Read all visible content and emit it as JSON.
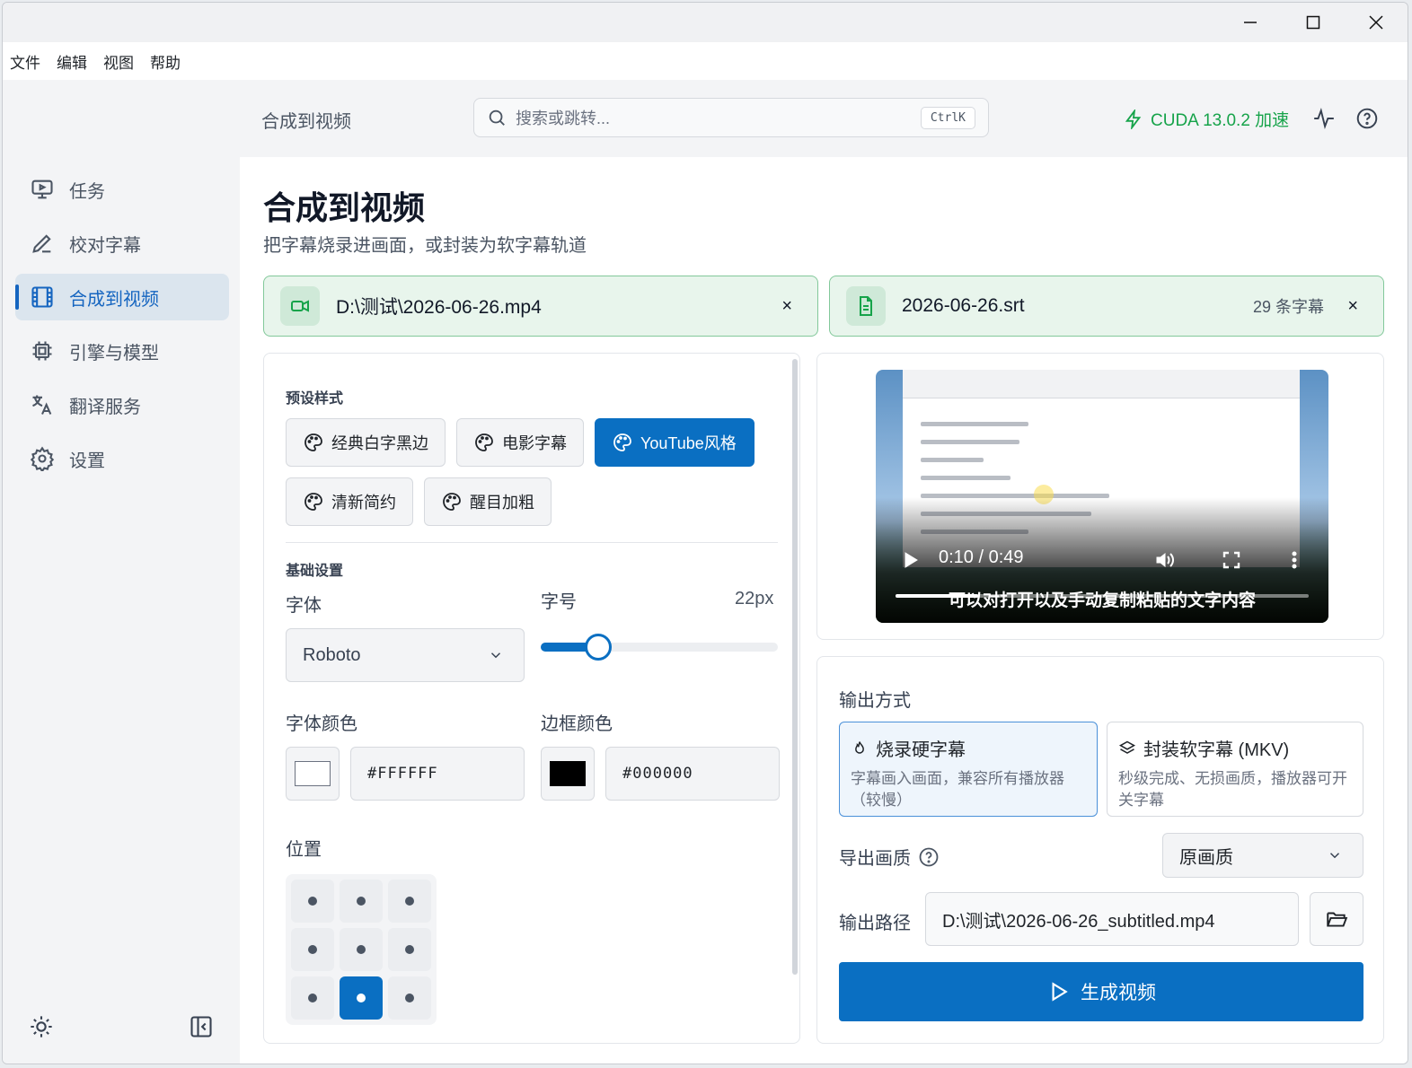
{
  "menu": [
    "文件",
    "编辑",
    "视图",
    "帮助"
  ],
  "sidebar": {
    "items": [
      {
        "label": "任务",
        "icon": "monitor-icon"
      },
      {
        "label": "校对字幕",
        "icon": "pen-icon"
      },
      {
        "label": "合成到视频",
        "icon": "film-icon",
        "active": true
      },
      {
        "label": "引擎与模型",
        "icon": "chip-icon"
      },
      {
        "label": "翻译服务",
        "icon": "translate-icon"
      },
      {
        "label": "设置",
        "icon": "gear-icon"
      }
    ]
  },
  "header": {
    "breadcrumb": "合成到视频",
    "search_placeholder": "搜索或跳转...",
    "shortcut": "CtrlK",
    "cuda_status": "CUDA 13.0.2 加速"
  },
  "page": {
    "title": "合成到视频",
    "subtitle": "把字幕烧录进画面，或封装为软字幕轨道"
  },
  "video_file": {
    "name": "D:\\测试\\2026-06-26.mp4",
    "close": "×"
  },
  "subtitle_file": {
    "name": "2026-06-26.srt",
    "count": "29 条字幕",
    "close": "×"
  },
  "presets": {
    "label": "预设样式",
    "items": [
      "经典白字黑边",
      "电影字幕",
      "YouTube风格",
      "清新简约",
      "醒目加粗"
    ],
    "active_index": 2
  },
  "basic": {
    "label": "基础设置",
    "font_label": "字体",
    "font_value": "Roboto",
    "size_label": "字号",
    "size_value": "22px",
    "size_fraction": 0.2,
    "font_color_label": "字体颜色",
    "font_color": "#FFFFFF",
    "border_color_label": "边框颜色",
    "border_color": "#000000",
    "position_label": "位置",
    "position_selected": "bottom-center"
  },
  "preview": {
    "time": "0:10 / 0:49",
    "subtitle_text": "可以对打开以及手动复制粘贴的文字内容",
    "progress_fraction": 0.2
  },
  "output": {
    "mode_label": "输出方式",
    "burn_title": "烧录硬字幕",
    "burn_desc": "字幕画入画面，兼容所有播放器（较慢）",
    "mkv_title": "封装软字幕 (MKV)",
    "mkv_desc": "秒级完成、无损画质，播放器可开关字幕",
    "quality_label": "导出画质",
    "quality_value": "原画质",
    "path_label": "输出路径",
    "path_value": "D:\\测试\\2026-06-26_subtitled.mp4",
    "generate_label": "生成视频"
  },
  "colors": {
    "accent": "#0a6fc2",
    "success": "#16a34a"
  }
}
